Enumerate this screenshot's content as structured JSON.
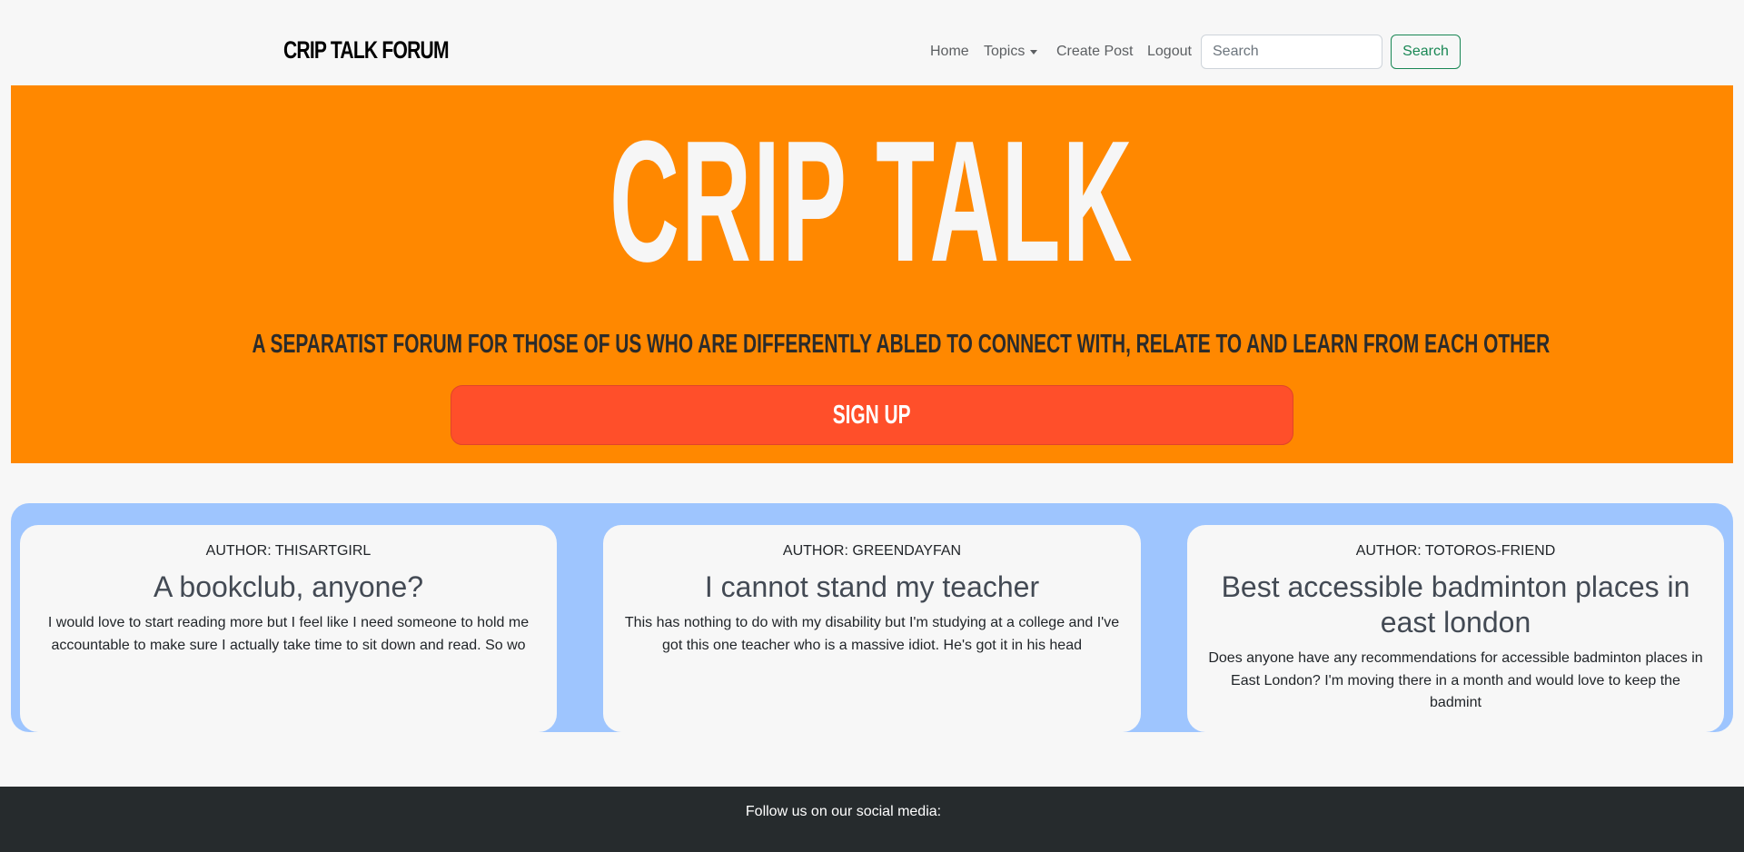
{
  "navbar": {
    "brand": "CRIP TALK FORUM",
    "links": {
      "home": "Home",
      "topics": "Topics",
      "create_post": "Create Post",
      "logout": "Logout"
    },
    "search": {
      "placeholder": "Search",
      "button": "Search"
    }
  },
  "hero": {
    "title": "CRIP TALK",
    "subtitle": "A SEPARATIST FORUM FOR THOSE OF US WHO ARE DIFFERENTLY ABLED TO CONNECT WITH, RELATE TO AND LEARN FROM EACH OTHER",
    "signup": "SIGN UP"
  },
  "posts": [
    {
      "author": "AUTHOR: THISARTGIRL",
      "title": "A bookclub, anyone?",
      "body": "I would love to start reading more but I feel like I need someone to hold me accountable to make sure I actually take time to sit down and read. So wo"
    },
    {
      "author": "AUTHOR: GREENDAYFAN",
      "title": "I cannot stand my teacher",
      "body": "This has nothing to do with my disability but I'm studying at a college and I've got this one teacher who is a massive idiot. He's got it in his head"
    },
    {
      "author": "AUTHOR: TOTOROS-FRIEND",
      "title": "Best accessible badminton places in east london",
      "body": "Does anyone have any recommendations for accessible badminton places in East London? I'm moving there in a month and would love to keep the badmint"
    }
  ],
  "footer": {
    "text": "Follow us on our social media:"
  },
  "colors": {
    "hero_bg": "#ff8800",
    "signup_bg": "#ff4f2a",
    "posts_band": "#9ec5fe",
    "footer_bg": "#262b2d",
    "search_accent": "#198754"
  }
}
